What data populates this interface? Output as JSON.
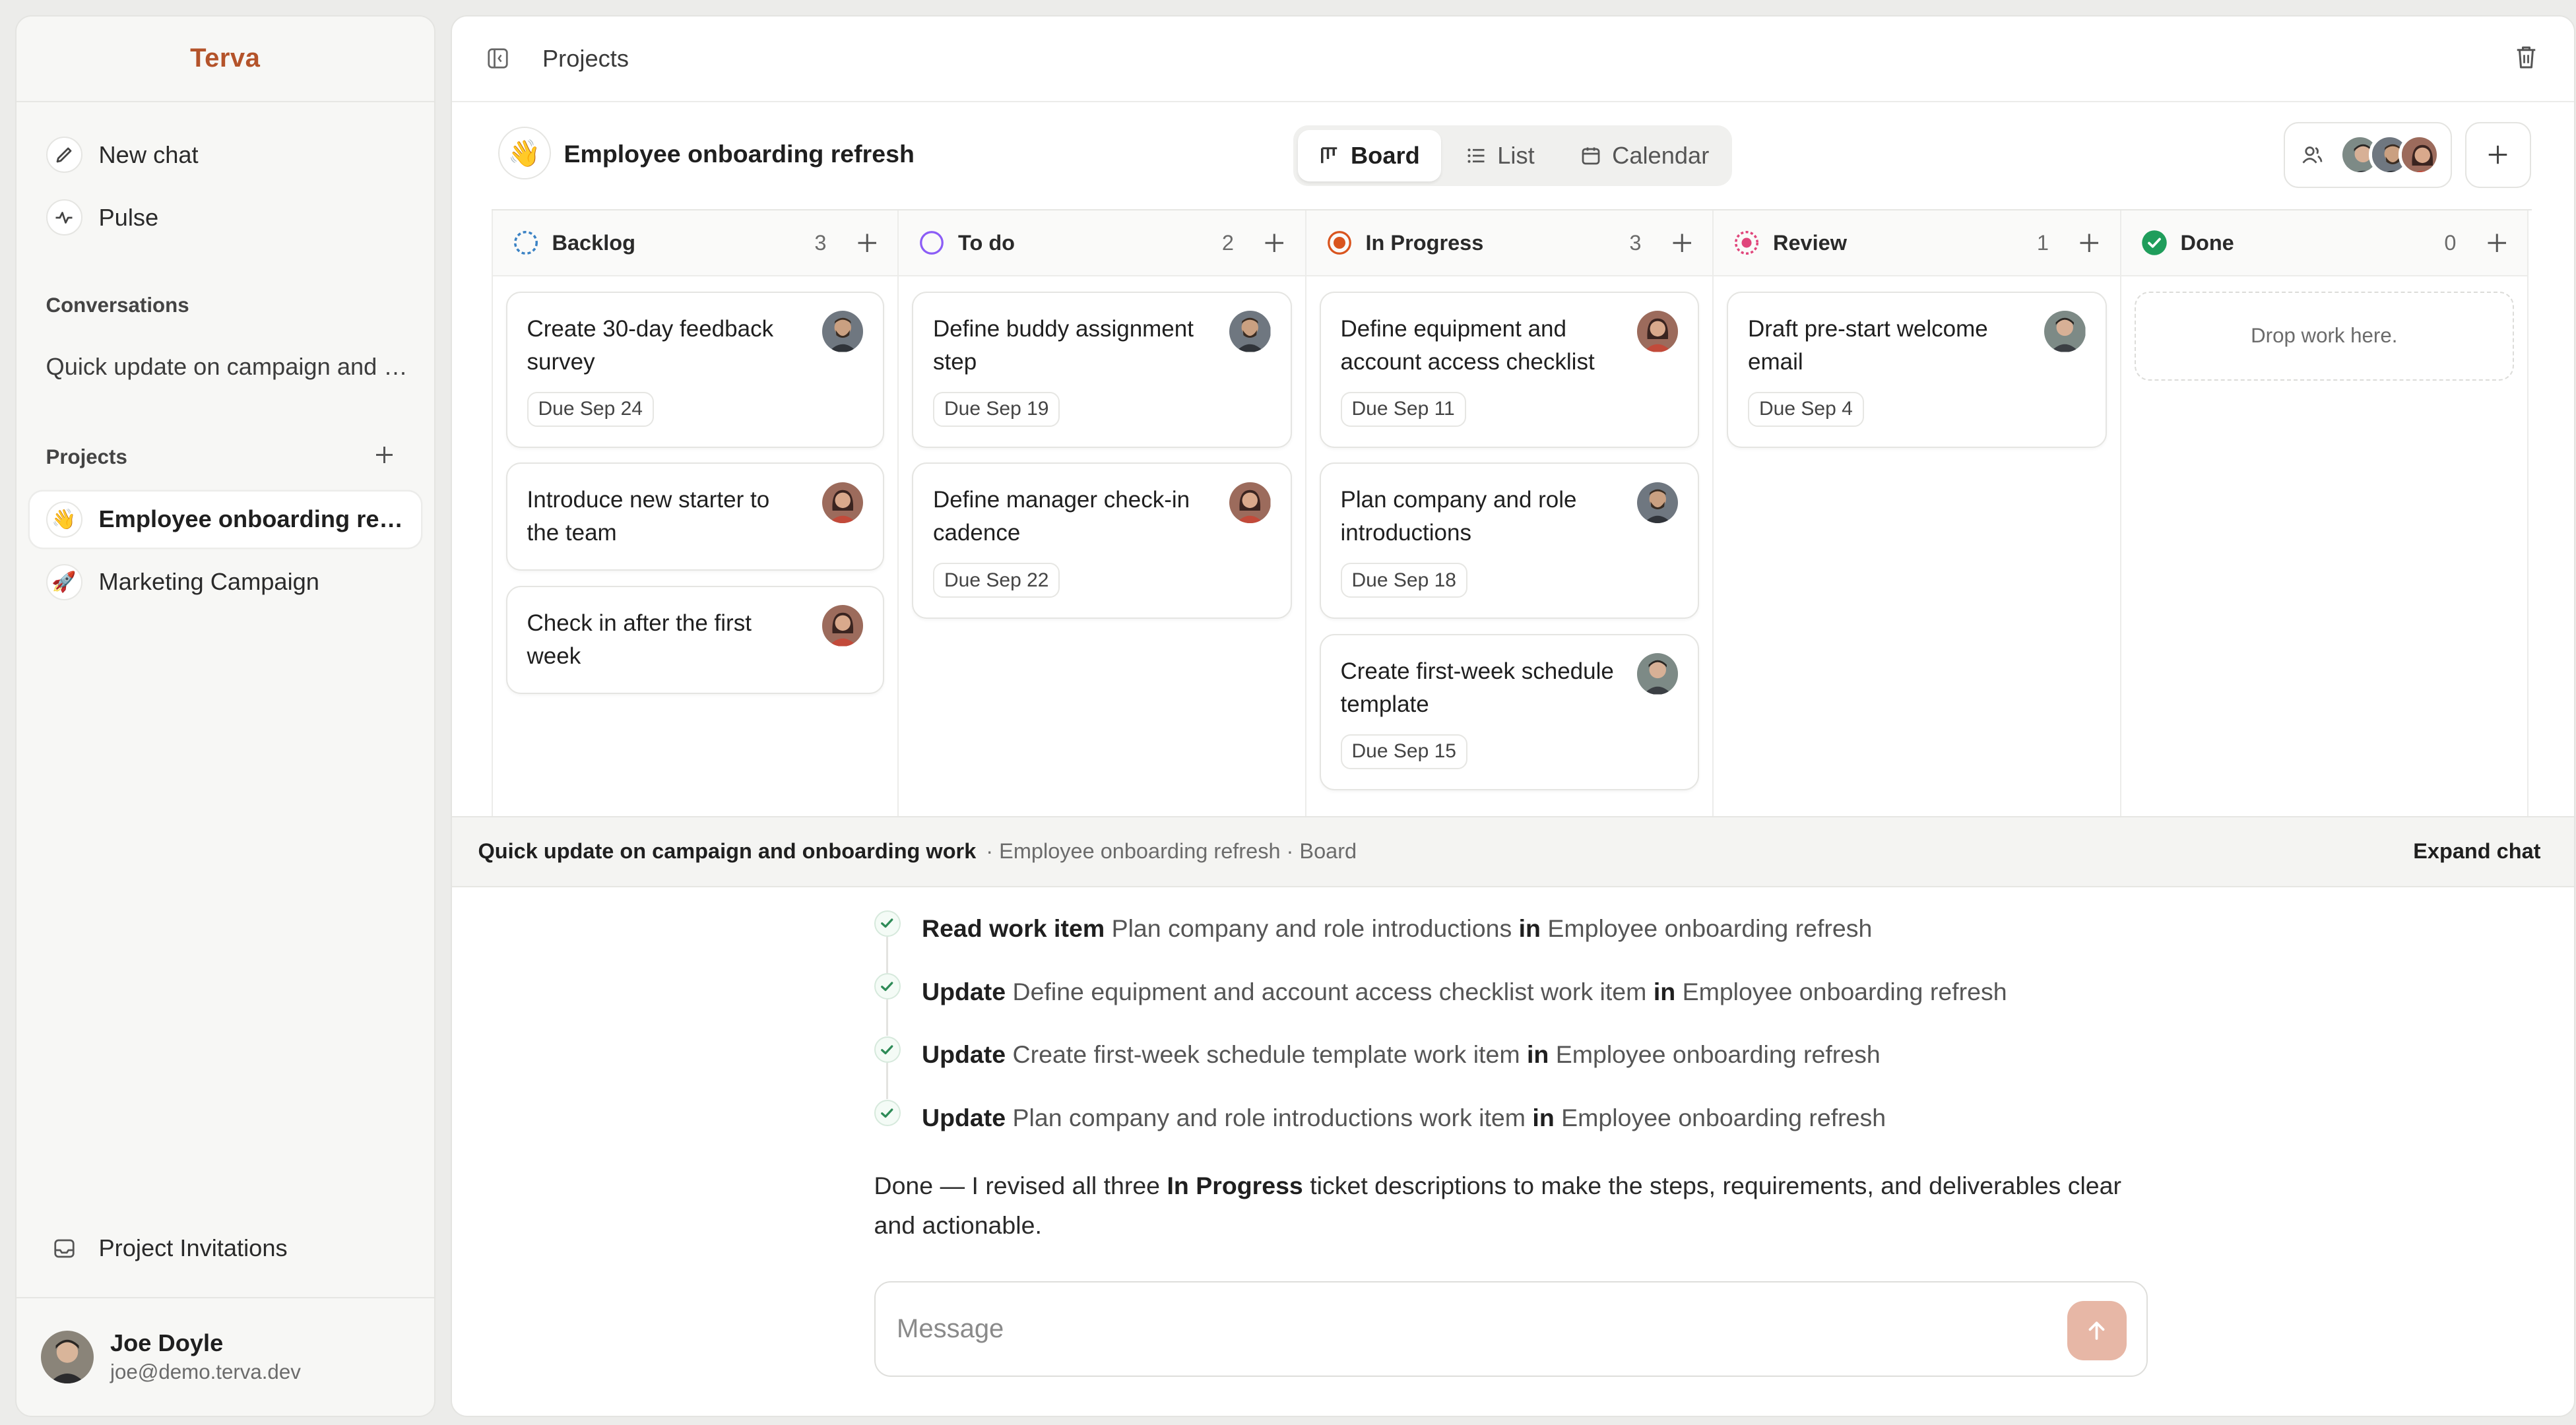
{
  "app": {
    "brand": "Terva"
  },
  "sidebar": {
    "nav": [
      {
        "label": "New chat",
        "icon": "pencil-icon"
      },
      {
        "label": "Pulse",
        "icon": "pulse-icon"
      }
    ],
    "conversations_label": "Conversations",
    "conversations": [
      "Quick update on campaign and onboarding work"
    ],
    "projects_label": "Projects",
    "projects": [
      {
        "label": "Employee onboarding refresh",
        "emoji": "👋",
        "active": true
      },
      {
        "label": "Marketing Campaign",
        "emoji": "🚀",
        "active": false
      }
    ],
    "invitations_label": "Project Invitations",
    "user": {
      "name": "Joe Doyle",
      "email": "joe@demo.terva.dev"
    }
  },
  "topbar": {
    "title": "Projects"
  },
  "project": {
    "emoji": "👋",
    "name": "Employee onboarding refresh",
    "views": [
      {
        "label": "Board",
        "active": true
      },
      {
        "label": "List",
        "active": false
      },
      {
        "label": "Calendar",
        "active": false
      }
    ]
  },
  "board": {
    "columns": [
      {
        "title": "Backlog",
        "count": "3",
        "status_color": "#3b82c4",
        "cards": [
          {
            "title": "Create 30-day feedback survey",
            "due": "Due Sep 24",
            "avatar": "man-beard"
          },
          {
            "title": "Introduce new starter to the team",
            "due": "",
            "avatar": "woman"
          },
          {
            "title": "Check in after the first week",
            "due": "",
            "avatar": "woman"
          }
        ]
      },
      {
        "title": "To do",
        "count": "2",
        "status_color": "#8b5cf6",
        "cards": [
          {
            "title": "Define buddy assignment step",
            "due": "Due Sep 19",
            "avatar": "man-beard"
          },
          {
            "title": "Define manager check-in cadence",
            "due": "Due Sep 22",
            "avatar": "woman"
          }
        ]
      },
      {
        "title": "In Progress",
        "count": "3",
        "status_color": "#d9541e",
        "cards": [
          {
            "title": "Define equipment and account access checklist",
            "due": "Due Sep 11",
            "avatar": "woman"
          },
          {
            "title": "Plan company and role introductions",
            "due": "Due Sep 18",
            "avatar": "man-beard"
          },
          {
            "title": "Create first-week schedule template",
            "due": "Due Sep 15",
            "avatar": "man"
          }
        ]
      },
      {
        "title": "Review",
        "count": "1",
        "status_color": "#e0457b",
        "cards": [
          {
            "title": "Draft pre-start welcome email",
            "due": "Due Sep 4",
            "avatar": "man"
          }
        ]
      },
      {
        "title": "Done",
        "count": "0",
        "status_color": "#1f9d5b",
        "cards": [],
        "empty_text": "Drop work here."
      }
    ]
  },
  "chat": {
    "title": "Quick update on campaign and onboarding work",
    "context": "· Employee onboarding refresh · Board",
    "expand_label": "Expand chat",
    "steps": [
      {
        "action": "Read work item",
        "target": "Plan company and role introductions",
        "in": "in",
        "project": "Employee onboarding refresh"
      },
      {
        "action": "Update",
        "target": "Define equipment and account access checklist work item",
        "in": "in",
        "project": "Employee onboarding refresh"
      },
      {
        "action": "Update",
        "target": "Create first-week schedule template work item",
        "in": "in",
        "project": "Employee onboarding refresh"
      },
      {
        "action": "Update",
        "target": "Plan company and role introductions work item",
        "in": "in",
        "project": "Employee onboarding refresh"
      }
    ],
    "reply": {
      "pre": "Done — I revised all three ",
      "bold": "In Progress",
      "post": " ticket descriptions to make the steps, requirements, and deliverables clear and actionable."
    },
    "composer": {
      "placeholder": "Message",
      "value": ""
    }
  },
  "colors": {
    "brand": "#b4532a",
    "send_button": "#e7b7a6"
  }
}
